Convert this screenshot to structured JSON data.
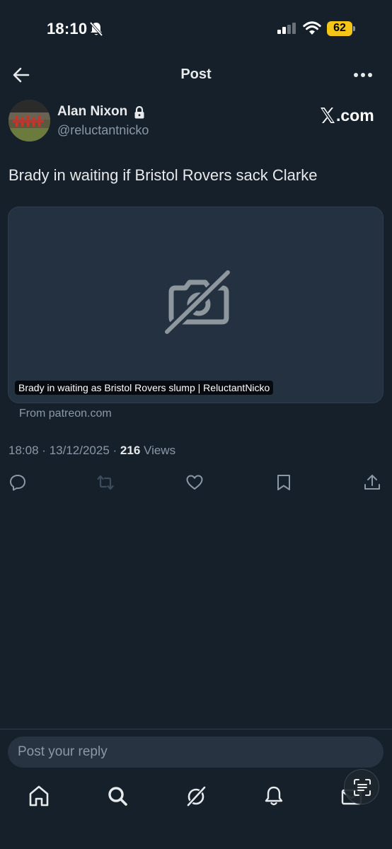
{
  "status_bar": {
    "time": "18:10",
    "battery": "62",
    "battery_color": "#f5c518",
    "icons": [
      "bell-off-icon",
      "signal-icon",
      "wifi-icon",
      "battery-icon"
    ]
  },
  "header": {
    "title": "Post",
    "back_icon": "arrow-left-icon",
    "more_icon": "more-horizontal-icon"
  },
  "author": {
    "name": "Alan Nixon",
    "handle": "@reluctantnicko",
    "protected_icon": "lock-icon",
    "source_logo": ".com"
  },
  "post": {
    "text": "Brady in waiting if Bristol Rovers sack Clarke",
    "card": {
      "image_icon": "image-unavailable-icon",
      "caption": "Brady in waiting as Bristol Rovers slump | ReluctantNicko",
      "source": "From patreon.com"
    },
    "time": "18:08",
    "date": "13/12/2025",
    "separator": "·",
    "views_count": "216",
    "views_label": "Views"
  },
  "actions": [
    "reply-icon",
    "repost-icon",
    "like-icon",
    "bookmark-icon",
    "share-icon"
  ],
  "reply": {
    "placeholder": "Post your reply"
  },
  "tabbar": [
    "home-icon",
    "search-icon",
    "grok-icon",
    "notifications-icon",
    "messages-icon"
  ],
  "colors": {
    "background": "#15202b",
    "card": "#233141",
    "muted_text": "#8b98a5",
    "primary_text": "#e7e9ea"
  }
}
